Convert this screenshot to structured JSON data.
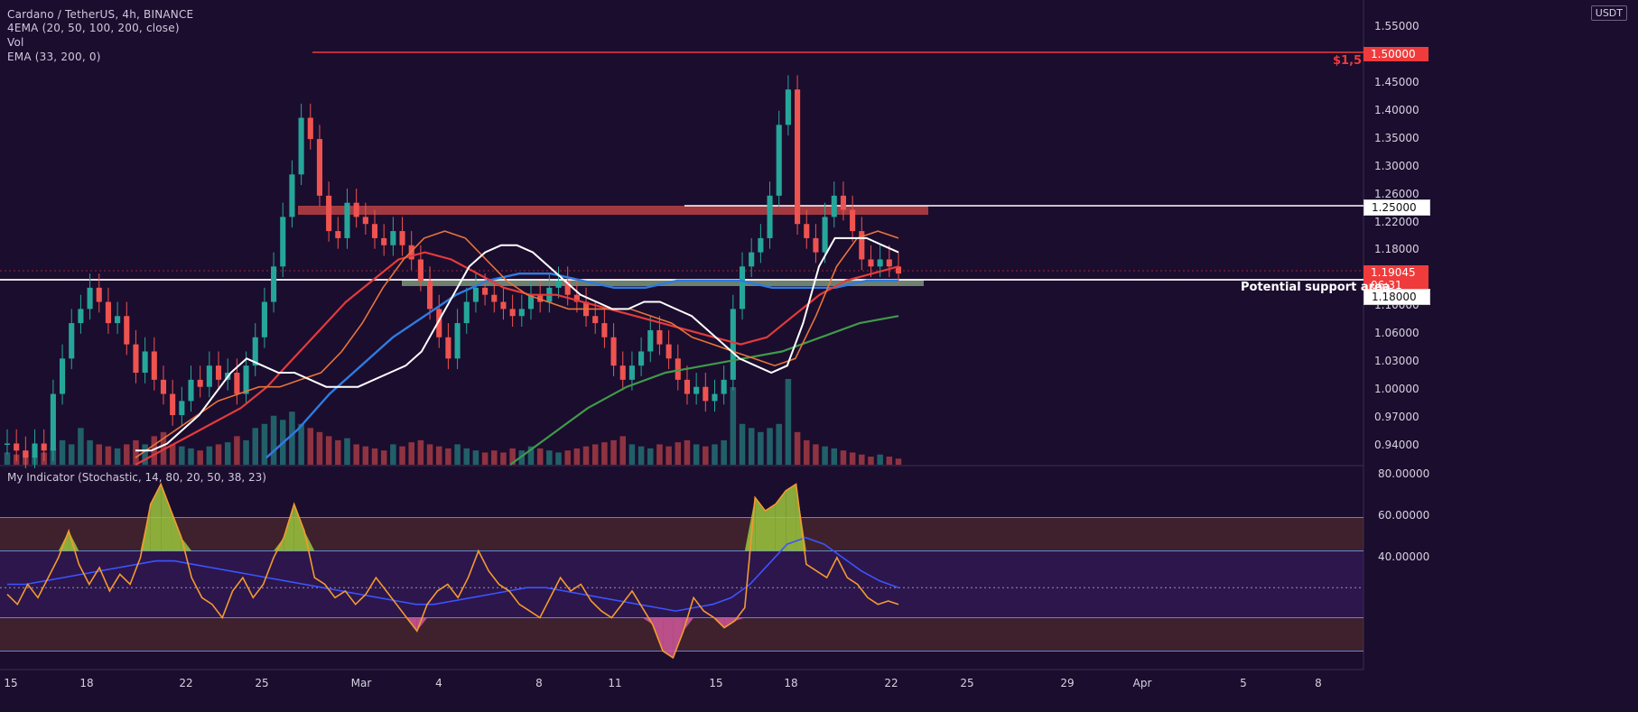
{
  "legend": {
    "line1": "Cardano / TetherUS, 4h, BINANCE",
    "line2": "4EMA (20, 50, 100, 200, close)",
    "line3": "Vol",
    "line4": "EMA (33, 200, 0)",
    "osc": "My Indicator (Stochastic, 14, 80, 20, 50, 38, 23)"
  },
  "currency_label": "USDT",
  "price_axis": [
    "1.55000",
    "1.50000",
    "1.45000",
    "1.40000",
    "1.35000",
    "1.30000",
    "1.26000",
    "1.22000",
    "1.18000",
    "1.14000",
    "1.10000",
    "1.06000",
    "1.03000",
    "1.00000",
    "0.97000",
    "0.94000"
  ],
  "osc_axis": [
    "80.00000",
    "60.00000",
    "40.00000"
  ],
  "date_axis": [
    "15",
    "18",
    "22",
    "25",
    "Mar",
    "4",
    "8",
    "11",
    "15",
    "18",
    "22",
    "25",
    "29",
    "Apr",
    "5",
    "8"
  ],
  "tags": {
    "resistance_value": "1.50000",
    "resistance_label": "$1,5",
    "upper_level": "1.25000",
    "last_price": "1.19045",
    "countdown": "06:31",
    "support_level": "1.18000",
    "support_label": "Potential support area"
  },
  "colors": {
    "background": "#1b0d2e",
    "up": "#26a69a",
    "down": "#ef5350",
    "ema20": "#ffffff",
    "ema50": "#e8743b",
    "ema100": "#e33b3b",
    "ema200": "#2f7be0",
    "ema_long": "#3f9a4a",
    "resistance": "#ef3b3b",
    "osc_line": "#f39a2f",
    "osc_signal": "#3c54ff"
  },
  "chart_data": {
    "type": "candlestick",
    "symbol": "ADA/USDT",
    "timeframe": "4h",
    "ylim": [
      0.92,
      1.57
    ],
    "levels": [
      1.5,
      1.25,
      1.18
    ],
    "zones": [
      {
        "name": "resistance zone",
        "range": [
          1.235,
          1.245
        ]
      },
      {
        "name": "support zone",
        "range": [
          1.176,
          1.184
        ]
      }
    ],
    "close": [
      0.95,
      0.94,
      0.93,
      0.95,
      0.94,
      1.02,
      1.07,
      1.12,
      1.14,
      1.17,
      1.15,
      1.12,
      1.13,
      1.09,
      1.05,
      1.08,
      1.04,
      1.02,
      0.99,
      1.01,
      1.04,
      1.03,
      1.06,
      1.04,
      1.05,
      1.02,
      1.06,
      1.1,
      1.15,
      1.2,
      1.27,
      1.33,
      1.41,
      1.38,
      1.3,
      1.25,
      1.24,
      1.29,
      1.27,
      1.26,
      1.24,
      1.23,
      1.25,
      1.23,
      1.21,
      1.18,
      1.14,
      1.1,
      1.07,
      1.12,
      1.15,
      1.17,
      1.16,
      1.15,
      1.14,
      1.13,
      1.14,
      1.16,
      1.15,
      1.17,
      1.18,
      1.16,
      1.15,
      1.13,
      1.12,
      1.1,
      1.06,
      1.04,
      1.06,
      1.08,
      1.11,
      1.09,
      1.07,
      1.04,
      1.02,
      1.03,
      1.01,
      1.02,
      1.04,
      1.14,
      1.2,
      1.22,
      1.24,
      1.3,
      1.4,
      1.45,
      1.26,
      1.24,
      1.22,
      1.27,
      1.3,
      1.28,
      1.25,
      1.21,
      1.2,
      1.21,
      1.2,
      1.19
    ],
    "volume": [
      0.3,
      0.25,
      0.35,
      0.2,
      0.3,
      0.4,
      0.6,
      0.5,
      0.9,
      0.6,
      0.5,
      0.45,
      0.4,
      0.5,
      0.6,
      0.5,
      0.7,
      0.8,
      0.5,
      0.45,
      0.4,
      0.35,
      0.45,
      0.5,
      0.55,
      0.7,
      0.6,
      0.9,
      1.0,
      1.2,
      1.1,
      1.3,
      1.0,
      0.9,
      0.8,
      0.7,
      0.6,
      0.65,
      0.5,
      0.45,
      0.4,
      0.35,
      0.5,
      0.45,
      0.55,
      0.6,
      0.5,
      0.45,
      0.4,
      0.5,
      0.4,
      0.35,
      0.3,
      0.35,
      0.3,
      0.4,
      0.35,
      0.45,
      0.4,
      0.35,
      0.3,
      0.35,
      0.4,
      0.45,
      0.5,
      0.55,
      0.6,
      0.7,
      0.5,
      0.45,
      0.4,
      0.5,
      0.45,
      0.55,
      0.6,
      0.5,
      0.45,
      0.5,
      0.6,
      1.9,
      1.0,
      0.9,
      0.8,
      0.9,
      1.0,
      2.1,
      0.8,
      0.6,
      0.5,
      0.45,
      0.4,
      0.35,
      0.3,
      0.25,
      0.2,
      0.25,
      0.2,
      0.15
    ],
    "ema20": [
      0.94,
      0.94,
      0.95,
      0.97,
      0.99,
      1.02,
      1.05,
      1.07,
      1.06,
      1.05,
      1.05,
      1.04,
      1.03,
      1.03,
      1.03,
      1.04,
      1.05,
      1.06,
      1.08,
      1.12,
      1.16,
      1.2,
      1.22,
      1.23,
      1.23,
      1.22,
      1.2,
      1.18,
      1.16,
      1.15,
      1.14,
      1.14,
      1.15,
      1.15,
      1.14,
      1.13,
      1.11,
      1.09,
      1.07,
      1.06,
      1.05,
      1.06,
      1.12,
      1.2,
      1.24,
      1.24,
      1.24,
      1.23,
      1.22
    ],
    "ema50": [
      0.93,
      0.95,
      0.97,
      0.99,
      1.01,
      1.02,
      1.03,
      1.03,
      1.04,
      1.05,
      1.08,
      1.12,
      1.17,
      1.21,
      1.24,
      1.25,
      1.24,
      1.21,
      1.18,
      1.16,
      1.15,
      1.14,
      1.14,
      1.14,
      1.14,
      1.13,
      1.12,
      1.1,
      1.09,
      1.08,
      1.07,
      1.06,
      1.07,
      1.13,
      1.2,
      1.24,
      1.25,
      1.24
    ],
    "ema100": [
      0.92,
      0.94,
      0.96,
      0.98,
      1.0,
      1.03,
      1.07,
      1.11,
      1.15,
      1.18,
      1.21,
      1.22,
      1.21,
      1.19,
      1.17,
      1.16,
      1.16,
      1.15,
      1.14,
      1.13,
      1.12,
      1.11,
      1.1,
      1.09,
      1.1,
      1.13,
      1.16,
      1.18,
      1.19,
      1.2
    ],
    "ema200": [
      0.93,
      0.97,
      1.02,
      1.06,
      1.1,
      1.13,
      1.16,
      1.18,
      1.19,
      1.19,
      1.18,
      1.17,
      1.17,
      1.18,
      1.18,
      1.18,
      1.17,
      1.17,
      1.17,
      1.18,
      1.18
    ],
    "ema_long": [
      0.92,
      0.96,
      1.0,
      1.03,
      1.05,
      1.06,
      1.07,
      1.08,
      1.1,
      1.12,
      1.13
    ],
    "oscillator": {
      "ylim": [
        25,
        85
      ],
      "bands": [
        30,
        40,
        49,
        60,
        70
      ],
      "line": [
        47,
        44,
        50,
        46,
        52,
        58,
        66,
        56,
        50,
        55,
        48,
        53,
        50,
        58,
        74,
        80,
        72,
        64,
        52,
        46,
        44,
        40,
        48,
        52,
        46,
        50,
        58,
        64,
        74,
        66,
        52,
        50,
        46,
        48,
        44,
        47,
        52,
        48,
        44,
        40,
        36,
        44,
        48,
        50,
        46,
        52,
        60,
        54,
        50,
        48,
        44,
        42,
        40,
        46,
        52,
        48,
        50,
        45,
        42,
        40,
        44,
        48,
        43,
        38,
        30,
        28,
        36,
        46,
        42,
        40,
        37,
        39,
        43,
        76,
        72,
        74,
        78,
        80,
        56,
        54,
        52,
        58,
        52,
        50,
        46,
        44,
        45,
        44
      ],
      "signal": [
        50,
        50,
        51,
        52,
        53,
        54,
        55,
        56,
        57,
        57,
        56,
        55,
        54,
        53,
        52,
        51,
        50,
        49,
        48,
        47,
        46,
        45,
        44,
        44,
        45,
        46,
        47,
        48,
        49,
        49,
        48,
        47,
        46,
        45,
        44,
        43,
        42,
        43,
        44,
        46,
        50,
        56,
        62,
        64,
        62,
        58,
        54,
        51,
        49
      ]
    }
  }
}
